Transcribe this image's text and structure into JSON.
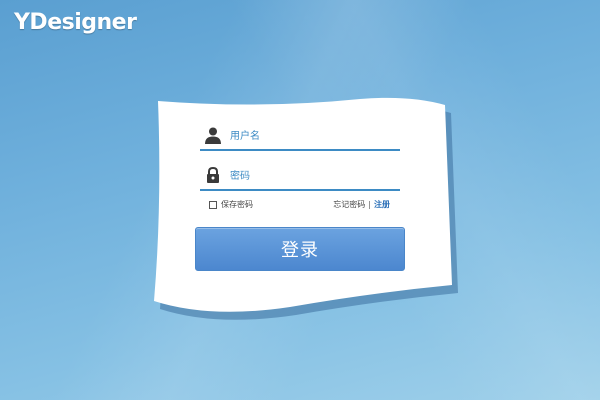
{
  "brand": {
    "logo_text": "YDesigner"
  },
  "login": {
    "username_placeholder": "用户名",
    "password_placeholder": "密码",
    "remember_label": "保存密码",
    "forgot_label": "忘记密码",
    "separator": "|",
    "register_label": "注册",
    "submit_label": "登录"
  },
  "icons": {
    "username": "user-icon",
    "password": "lock-icon"
  },
  "colors": {
    "accent": "#3d8bc4",
    "button": "#5a96d8",
    "register_link": "#2a6fb8"
  }
}
